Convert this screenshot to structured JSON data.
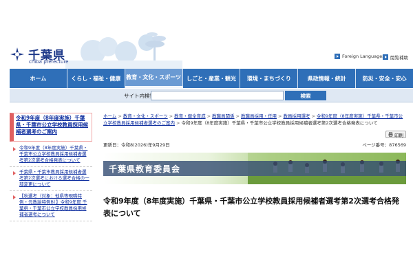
{
  "header": {
    "logo_text": "千葉県",
    "logo_sub": "chiba prefecture",
    "util": {
      "foreign_languages": "Foreign Languages",
      "viewing_support": "閲覧補助"
    }
  },
  "gnav": {
    "items": [
      {
        "label": "ホーム"
      },
      {
        "label": "くらし・福祉・健康"
      },
      {
        "label": "教育・文化・スポーツ"
      },
      {
        "label": "しごと・産業・観光"
      },
      {
        "label": "環境・まちづくり"
      },
      {
        "label": "県政情報・統計"
      },
      {
        "label": "防災・安全・安心"
      }
    ],
    "active_index": 2
  },
  "search": {
    "label": "サイト内検索",
    "value": "",
    "button": "検索"
  },
  "sidebar": {
    "heading": "令和9年度（8年度実施）千葉県・千葉市公立学校教員採用候補者選考のご案内",
    "items": [
      {
        "label": "令和9年度（8年度実施）千葉県・千葉市公立学校教員採用候補者選考第2次選考合格発表について"
      },
      {
        "label": "千葉県・千葉市教員採用候補者選考第2次選考における選考合格の一部変更について"
      },
      {
        "label": "【秋選考（対象：他県等現職特例・元教諭特例B）】令和9年度 千葉県・千葉市公立学校教員採用候補者選考について"
      }
    ]
  },
  "main": {
    "breadcrumbs": [
      "ホーム",
      "教育・文化・スポーツ",
      "教育・健全育成",
      "教職員関係",
      "教職員採用・任用",
      "教員採用選考",
      "令和9年度（8年度実施）千葉県・千葉市公立学校教員採用候補者選考のご案内",
      "令和9年度（8年度実施）千葉県・千葉市公立学校教員採用候補者選考第2次選考合格発表について"
    ],
    "print_label": "印刷",
    "updated": "更新日：令和8(2026)年9月29日",
    "page_id": "ページ番号：876569",
    "banner_title": "千葉県教育委員会",
    "page_title": "令和9年度（8年度実施）千葉県・千葉市公立学校教員採用候補者選考第2次選考合格発表について"
  },
  "colors": {
    "nav_blue": "#2f6fb8",
    "nav_active": "#6a9ad3",
    "logo_navy": "#1f3a8a",
    "sidebar_accent": "#e06060",
    "link": "#1030a0"
  }
}
